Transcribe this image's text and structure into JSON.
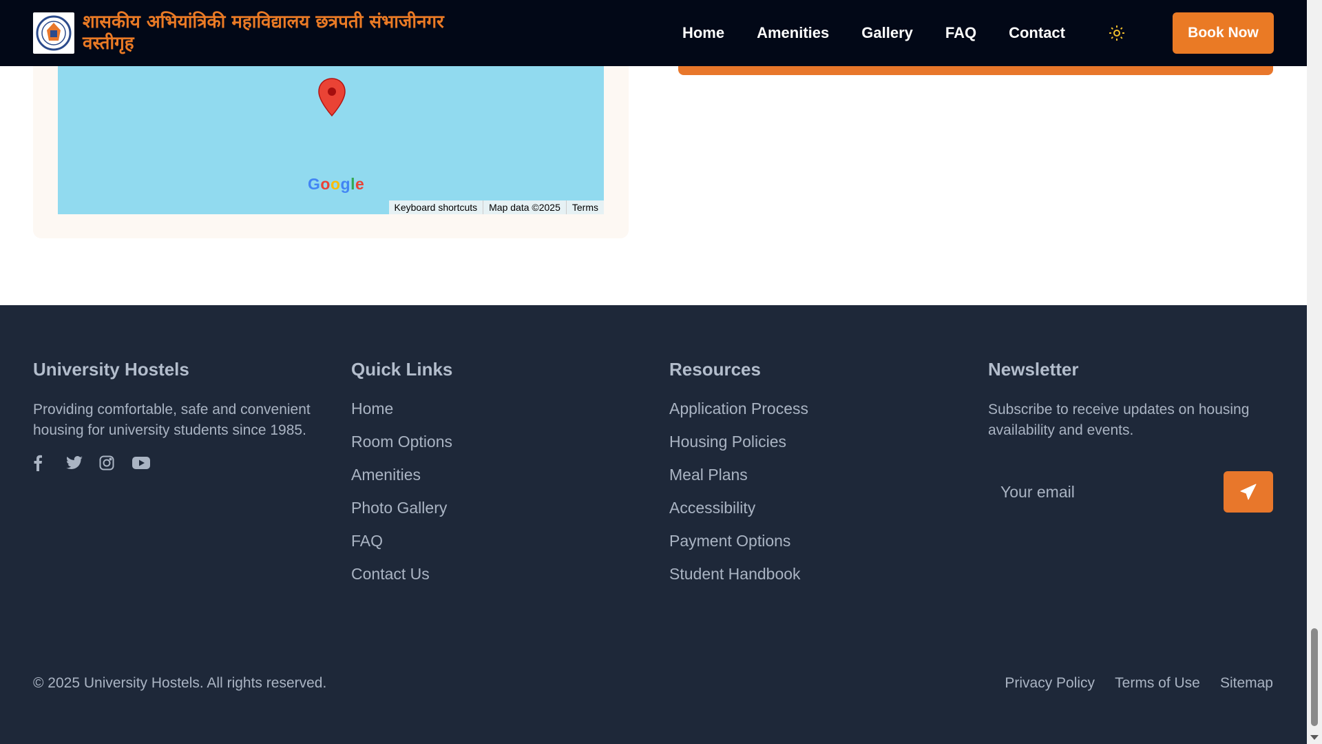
{
  "header": {
    "title": "शासकीय अभियांत्रिकी महाविद्यालय छत्रपती संभाजीनगर वस्तीगृह",
    "nav": [
      "Home",
      "Amenities",
      "Gallery",
      "FAQ",
      "Contact"
    ],
    "book_label": "Book Now",
    "theme_icon": "sun-icon",
    "accent": "#ea7a25"
  },
  "map": {
    "attribution": [
      "Keyboard shortcuts",
      "Map data ©2025",
      "Terms"
    ],
    "logo_text": "Google"
  },
  "footer": {
    "about": {
      "heading": "University Hostels",
      "text": "Providing comfortable, safe and convenient housing for university students since 1985.",
      "social": [
        "facebook-icon",
        "twitter-icon",
        "instagram-icon",
        "youtube-icon"
      ]
    },
    "quick_links": {
      "heading": "Quick Links",
      "items": [
        "Home",
        "Room Options",
        "Amenities",
        "Photo Gallery",
        "FAQ",
        "Contact Us"
      ]
    },
    "resources": {
      "heading": "Resources",
      "items": [
        "Application Process",
        "Housing Policies",
        "Meal Plans",
        "Accessibility",
        "Payment Options",
        "Student Handbook"
      ]
    },
    "newsletter": {
      "heading": "Newsletter",
      "text": "Subscribe to receive updates on housing availability and events.",
      "placeholder": "Your email"
    },
    "copyright": "© 2025 University Hostels. All rights reserved.",
    "legal": [
      "Privacy Policy",
      "Terms of Use",
      "Sitemap"
    ]
  }
}
